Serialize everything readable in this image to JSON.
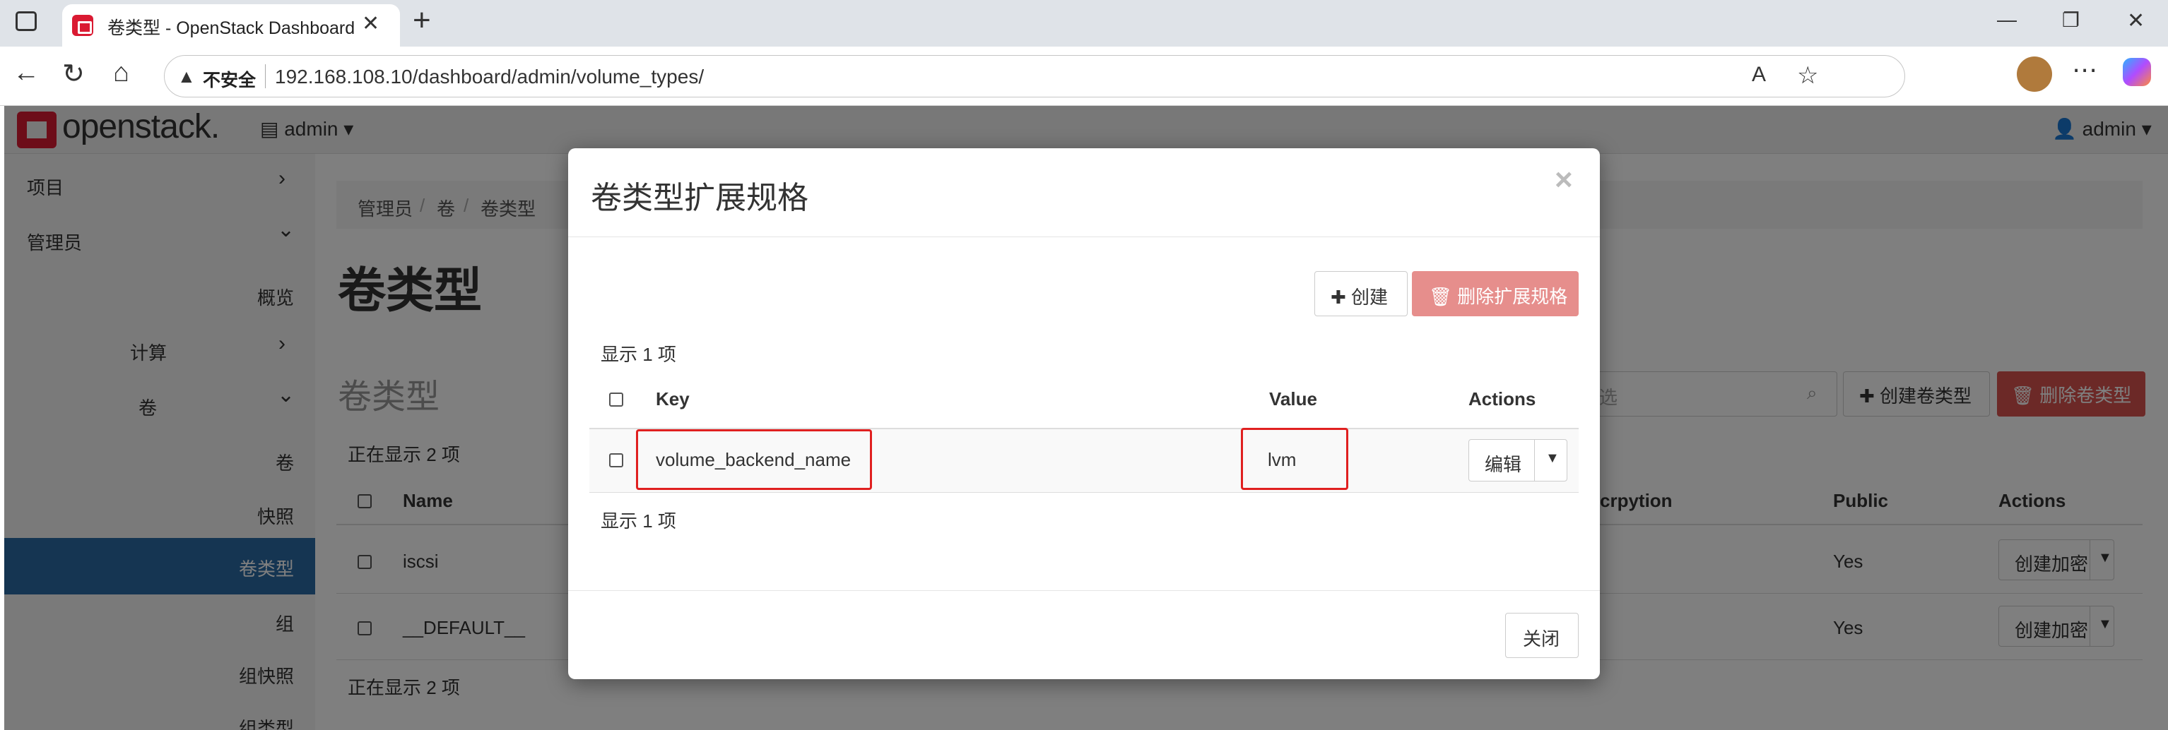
{
  "browser": {
    "tab_title": "卷类型 - OpenStack Dashboard",
    "tab_close": "✕",
    "new_tab": "+",
    "security_label": "不安全",
    "url": "192.168.108.10/dashboard/admin/volume_types/",
    "window_controls": [
      "—",
      "❐",
      "✕"
    ]
  },
  "header": {
    "logo_text": "openstack.",
    "project": "admin",
    "user": "admin"
  },
  "sidebar": {
    "items": [
      {
        "label": "项目",
        "chevron": "›"
      },
      {
        "label": "管理员",
        "chevron": "⌄"
      },
      {
        "label": "概览"
      },
      {
        "label": "计算",
        "chevron": "›"
      },
      {
        "label": "卷",
        "chevron": "⌄"
      },
      {
        "label": "卷"
      },
      {
        "label": "快照"
      },
      {
        "label": "卷类型",
        "active": true
      },
      {
        "label": "组"
      },
      {
        "label": "组快照"
      },
      {
        "label": "组类型"
      }
    ]
  },
  "breadcrumb": [
    "管理员",
    "卷",
    "卷类型"
  ],
  "page": {
    "title": "卷类型",
    "subtitle": "卷类型",
    "filter_placeholder": "选",
    "create_button": "创建卷类型",
    "delete_button": "删除卷类型",
    "showing_top": "正在显示 2 项",
    "showing_bottom": "正在显示 2 项",
    "columns": [
      "Name",
      "crpytion",
      "Public",
      "Actions"
    ],
    "rows": [
      {
        "name": "iscsi",
        "public": "Yes",
        "action": "创建加密"
      },
      {
        "name": "__DEFAULT__",
        "public": "Yes",
        "action": "创建加密"
      }
    ]
  },
  "modal": {
    "title": "卷类型扩展规格",
    "close_x": "×",
    "create_button": "创建",
    "delete_button": "删除扩展规格",
    "count_top": "显示 1 项",
    "count_bottom": "显示 1 项",
    "columns": {
      "key": "Key",
      "value": "Value",
      "actions": "Actions"
    },
    "rows": [
      {
        "key": "volume_backend_name",
        "value": "lvm",
        "action": "编辑"
      }
    ],
    "footer_close": "关闭"
  },
  "colors": {
    "accent_blue": "#2a6aa4",
    "danger": "#d9534f",
    "highlight_box": "#e02020",
    "openstack_red": "#da1a32"
  }
}
